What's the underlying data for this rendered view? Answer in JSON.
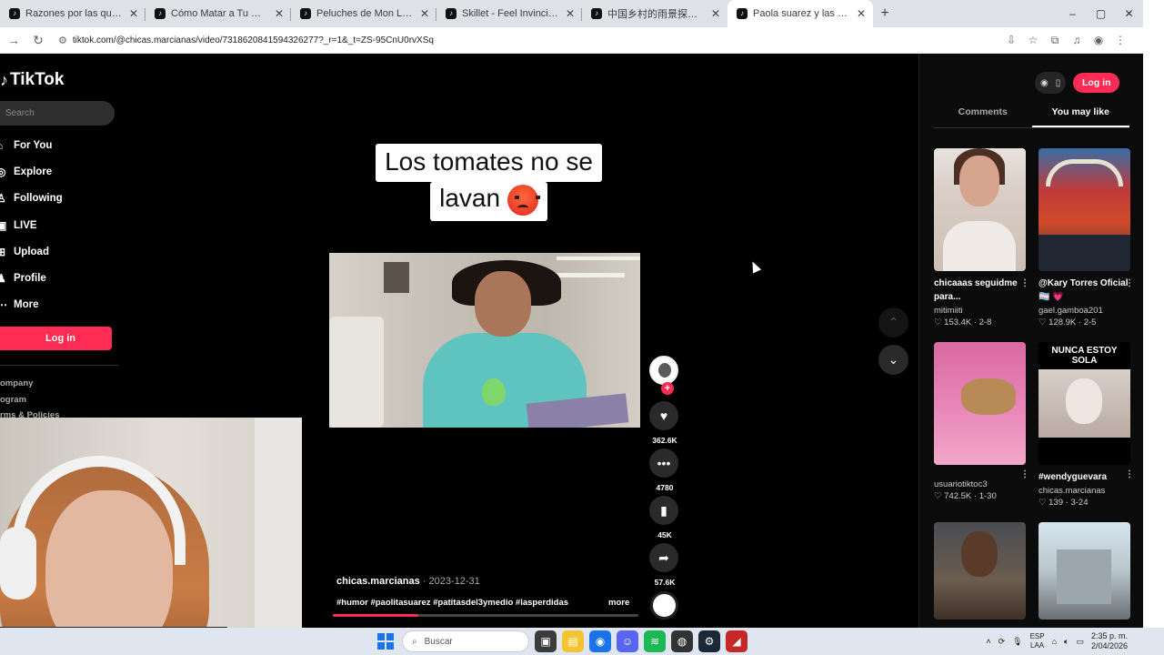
{
  "browser": {
    "tabs": [
      {
        "title": "Razones por las que no contest",
        "active": false
      },
      {
        "title": "Cómo Matar a Tu Pou: Humor y",
        "active": false
      },
      {
        "title": "Peluches de Mon Laferte y tuto",
        "active": false
      },
      {
        "title": "Skillet - Feel Invincible | Rock Ar",
        "active": false
      },
      {
        "title": "中国乡村的雨景探索 | TikTok",
        "active": false
      },
      {
        "title": "Paola suarez y las divertidas pe",
        "active": true
      }
    ],
    "new_tab": "+",
    "window_controls": {
      "minimize": "–",
      "maximize": "▢",
      "close": "✕"
    },
    "url": "tiktok.com/@chicas.marcianas/video/7318620841594326277?_r=1&_t=ZS-95CnU0rvXSq"
  },
  "sidebar": {
    "logo_text": "TikTok",
    "search_placeholder": "Search",
    "items": [
      {
        "label": "For You",
        "icon": "home-icon"
      },
      {
        "label": "Explore",
        "icon": "compass-icon"
      },
      {
        "label": "Following",
        "icon": "following-icon"
      },
      {
        "label": "LIVE",
        "icon": "live-icon"
      },
      {
        "label": "Upload",
        "icon": "upload-icon"
      },
      {
        "label": "Profile",
        "icon": "profile-icon"
      },
      {
        "label": "More",
        "icon": "more-icon"
      }
    ],
    "login_label": "Log in",
    "links": [
      "ompany",
      "ogram",
      "rms & Policies"
    ]
  },
  "video": {
    "caption_line1": "Los tomates no se",
    "caption_line2": "lavan",
    "username": "chicas.marcianas",
    "date": " · 2023-12-31",
    "hashtags": "#humor #paolitasuarez #patitasdel3ymedio #lasperdidas",
    "more_label": "more",
    "progress": 0.28,
    "actions": {
      "likes": "362.6K",
      "comments": "4780",
      "saves": "45K",
      "shares": "57.6K"
    }
  },
  "panel": {
    "login_label": "Log in",
    "tabs": [
      {
        "label": "Comments",
        "active": false
      },
      {
        "label": "You may like",
        "active": true
      }
    ],
    "cards": [
      {
        "title": "chicaaas seguidme para...",
        "user": "mitimiiti",
        "likes": "153.4K",
        "age": "2-8"
      },
      {
        "title": "@Kary Torres Oficial 🏳️‍⚧️ 💗",
        "user": "gael.gamboa201",
        "likes": "128.9K",
        "age": "2-5"
      },
      {
        "title": "",
        "user": "usuariotiktoc3",
        "likes": "742.5K",
        "age": "1-30"
      },
      {
        "title": "#wendyguevara",
        "user": "chicas.marcianas",
        "likes": "139",
        "age": "3-24",
        "thumb_text": "NUNCA ESTOY SOLA"
      },
      {
        "title": "",
        "user": "",
        "likes": "",
        "age": ""
      },
      {
        "title": "",
        "user": "",
        "likes": "",
        "age": ""
      }
    ]
  },
  "taskbar": {
    "search_placeholder": "Buscar",
    "lang_top": "ESP",
    "lang_bottom": "LAA",
    "time": "2:35 p. m.",
    "date": "2/04/2026"
  },
  "colors": {
    "accent": "#fe2c55",
    "background": "#000000"
  }
}
